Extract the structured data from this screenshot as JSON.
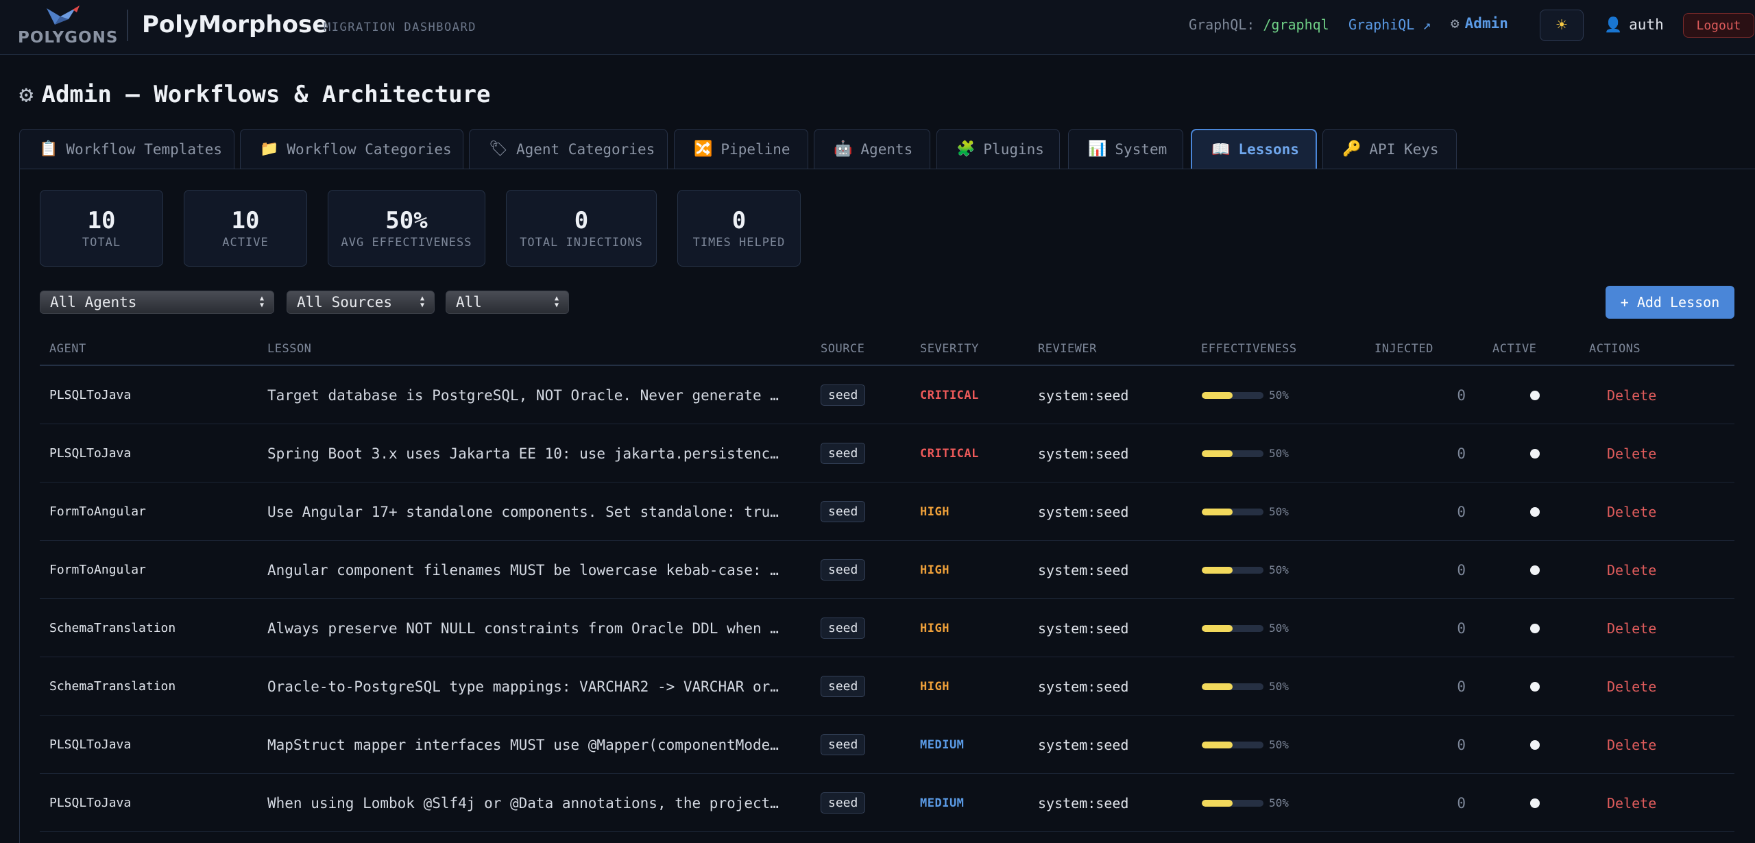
{
  "brand": {
    "logo_text": "POLYGONS",
    "app_title": "PolyMorphose",
    "app_subtitle": "MIGRATION DASHBOARD"
  },
  "topbar": {
    "graphql_label": "GraphQL:",
    "graphql_path": "/graphql",
    "graphiql_label": "GraphiQL ↗",
    "admin_label": "Admin",
    "user_label": "auth",
    "logout_label": "Logout"
  },
  "page": {
    "title": "Admin — Workflows & Architecture"
  },
  "tabs": [
    {
      "icon": "clipboard-icon",
      "glyph": "📋",
      "label": "Workflow Templates"
    },
    {
      "icon": "folder-icon",
      "glyph": "📁",
      "label": "Workflow Categories"
    },
    {
      "icon": "tag-icon",
      "glyph": "🏷",
      "label": "Agent Categories"
    },
    {
      "icon": "shuffle-icon",
      "glyph": "🔀",
      "label": "Pipeline"
    },
    {
      "icon": "robot-icon",
      "glyph": "🤖",
      "label": "Agents"
    },
    {
      "icon": "puzzle-icon",
      "glyph": "🧩",
      "label": "Plugins"
    },
    {
      "icon": "chart-icon",
      "glyph": "📊",
      "label": "System"
    },
    {
      "icon": "book-icon",
      "glyph": "📖",
      "label": "Lessons",
      "active": true
    },
    {
      "icon": "key-icon",
      "glyph": "🔑",
      "label": "API Keys"
    }
  ],
  "stats": [
    {
      "value": "10",
      "label": "TOTAL"
    },
    {
      "value": "10",
      "label": "ACTIVE"
    },
    {
      "value": "50%",
      "label": "AVG EFFECTIVENESS"
    },
    {
      "value": "0",
      "label": "TOTAL INJECTIONS"
    },
    {
      "value": "0",
      "label": "TIMES HELPED"
    }
  ],
  "filters": {
    "agent_selected": "All Agents",
    "source_selected": "All Sources",
    "severity_selected": "All"
  },
  "add_button_label": "+ Add Lesson",
  "table": {
    "headers": [
      "AGENT",
      "LESSON",
      "SOURCE",
      "SEVERITY",
      "REVIEWER",
      "EFFECTIVENESS",
      "INJECTED",
      "ACTIVE",
      "ACTIONS"
    ],
    "rows": [
      {
        "agent": "PLSQLToJava",
        "lesson": "Target database is PostgreSQL, NOT Oracle. Never generate …",
        "source": "seed",
        "severity": "CRITICAL",
        "reviewer": "system:seed",
        "effectiveness": 0.5,
        "effectiveness_label": "50%",
        "injected": "0",
        "active": true,
        "action": "Delete"
      },
      {
        "agent": "PLSQLToJava",
        "lesson": "Spring Boot 3.x uses Jakarta EE 10: use jakarta.persistenc…",
        "source": "seed",
        "severity": "CRITICAL",
        "reviewer": "system:seed",
        "effectiveness": 0.5,
        "effectiveness_label": "50%",
        "injected": "0",
        "active": true,
        "action": "Delete"
      },
      {
        "agent": "FormToAngular",
        "lesson": "Use Angular 17+ standalone components. Set standalone: tru…",
        "source": "seed",
        "severity": "HIGH",
        "reviewer": "system:seed",
        "effectiveness": 0.5,
        "effectiveness_label": "50%",
        "injected": "0",
        "active": true,
        "action": "Delete"
      },
      {
        "agent": "FormToAngular",
        "lesson": "Angular component filenames MUST be lowercase kebab-case: …",
        "source": "seed",
        "severity": "HIGH",
        "reviewer": "system:seed",
        "effectiveness": 0.5,
        "effectiveness_label": "50%",
        "injected": "0",
        "active": true,
        "action": "Delete"
      },
      {
        "agent": "SchemaTranslation",
        "lesson": "Always preserve NOT NULL constraints from Oracle DDL when …",
        "source": "seed",
        "severity": "HIGH",
        "reviewer": "system:seed",
        "effectiveness": 0.5,
        "effectiveness_label": "50%",
        "injected": "0",
        "active": true,
        "action": "Delete"
      },
      {
        "agent": "SchemaTranslation",
        "lesson": "Oracle-to-PostgreSQL type mappings: VARCHAR2 -> VARCHAR or…",
        "source": "seed",
        "severity": "HIGH",
        "reviewer": "system:seed",
        "effectiveness": 0.5,
        "effectiveness_label": "50%",
        "injected": "0",
        "active": true,
        "action": "Delete"
      },
      {
        "agent": "PLSQLToJava",
        "lesson": "MapStruct mapper interfaces MUST use @Mapper(componentMode…",
        "source": "seed",
        "severity": "MEDIUM",
        "reviewer": "system:seed",
        "effectiveness": 0.5,
        "effectiveness_label": "50%",
        "injected": "0",
        "active": true,
        "action": "Delete"
      },
      {
        "agent": "PLSQLToJava",
        "lesson": "When using Lombok @Slf4j or @Data annotations, the project…",
        "source": "seed",
        "severity": "MEDIUM",
        "reviewer": "system:seed",
        "effectiveness": 0.5,
        "effectiveness_label": "50%",
        "injected": "0",
        "active": true,
        "action": "Delete"
      }
    ]
  },
  "colors": {
    "background": "#0b0f17",
    "accent": "#4a86d8",
    "critical": "#ef5a5a",
    "high": "#f0a13a",
    "medium": "#5b9be6",
    "effectiveness_bar": "#f2d95c",
    "delete": "#e05c5c"
  }
}
